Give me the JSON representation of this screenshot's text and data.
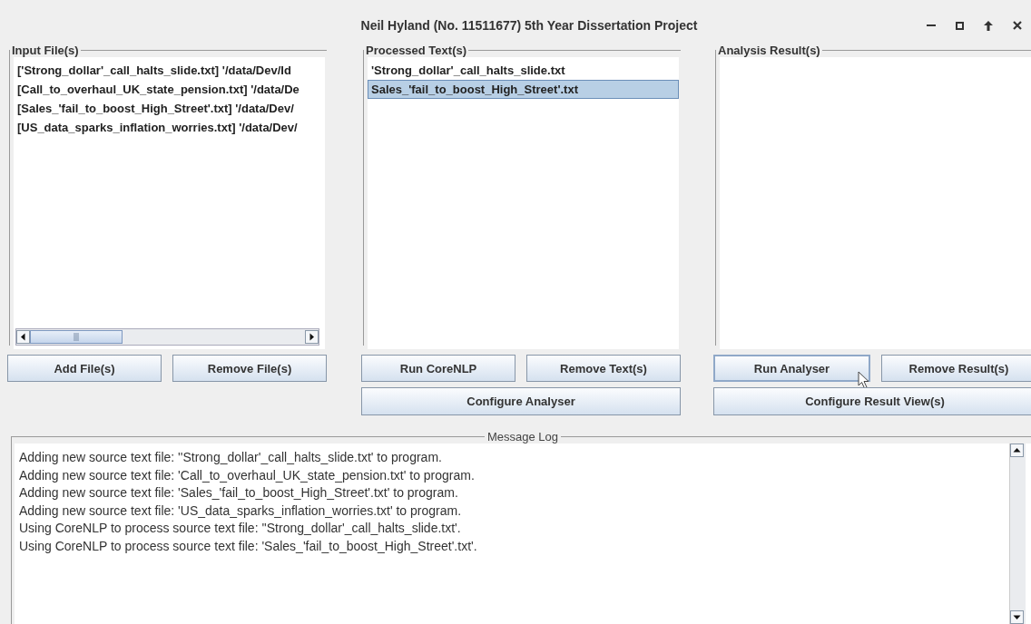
{
  "window": {
    "title": "Neil Hyland (No. 11511677) 5th Year Dissertation Project"
  },
  "panels": [
    {
      "title": "Input File(s)",
      "items": [
        {
          "text": "['Strong_dollar'_call_halts_slide.txt] '/data/Dev/Id",
          "selected": false
        },
        {
          "text": "[Call_to_overhaul_UK_state_pension.txt] '/data/De",
          "selected": false
        },
        {
          "text": "[Sales_'fail_to_boost_High_Street'.txt] '/data/Dev/",
          "selected": false
        },
        {
          "text": "[US_data_sparks_inflation_worries.txt] '/data/Dev/",
          "selected": false
        }
      ],
      "horizontal_scrollbar": true,
      "buttons": [
        {
          "label": "Add File(s)",
          "hovered": false
        },
        {
          "label": "Remove File(s)",
          "hovered": false
        }
      ]
    },
    {
      "title": "Processed Text(s)",
      "items": [
        {
          "text": "'Strong_dollar'_call_halts_slide.txt",
          "selected": false
        },
        {
          "text": "Sales_'fail_to_boost_High_Street'.txt",
          "selected": true
        }
      ],
      "buttons": [
        {
          "label": "Run CoreNLP",
          "hovered": false
        },
        {
          "label": "Remove Text(s)",
          "hovered": false
        }
      ],
      "wide_button": {
        "label": "Configure Analyser",
        "hovered": false
      }
    },
    {
      "title": "Analysis Result(s)",
      "buttons": [
        {
          "label": "Run Analyser",
          "hovered": true
        },
        {
          "label": "Remove Result(s)",
          "hovered": false
        }
      ],
      "wide_button": {
        "label": "Configure Result View(s)",
        "hovered": false
      }
    }
  ],
  "message_log": {
    "title": "Message Log",
    "lines": [
      "Adding new source text file: ''Strong_dollar'_call_halts_slide.txt' to program.",
      "Adding new source text file: 'Call_to_overhaul_UK_state_pension.txt' to program.",
      "Adding new source text file: 'Sales_'fail_to_boost_High_Street'.txt' to program.",
      "Adding new source text file: 'US_data_sparks_inflation_worries.txt' to program.",
      "Using CoreNLP to process source text file: ''Strong_dollar'_call_halts_slide.txt'.",
      "Using CoreNLP to process source text file: 'Sales_'fail_to_boost_High_Street'.txt'."
    ]
  }
}
